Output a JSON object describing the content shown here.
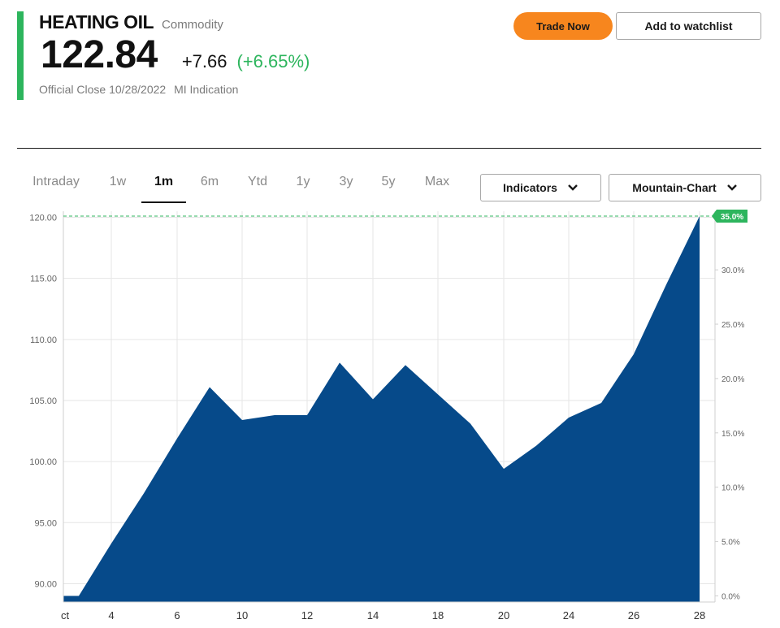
{
  "header": {
    "title": "HEATING OIL",
    "category": "Commodity",
    "price": "122.84",
    "change": "+7.66",
    "change_pct": "(+6.65%)",
    "close_label": "Official Close 10/28/2022",
    "source_label": "MI Indication",
    "trade_label": "Trade Now",
    "watchlist_label": "Add to watchlist"
  },
  "colors": {
    "accent_green": "#2db55d",
    "trade_orange": "#f7861e",
    "area_fill": "#064a8a"
  },
  "tabs": [
    {
      "label": "Intraday",
      "active": false
    },
    {
      "label": "1w",
      "active": false
    },
    {
      "label": "1m",
      "active": true
    },
    {
      "label": "6m",
      "active": false
    },
    {
      "label": "Ytd",
      "active": false
    },
    {
      "label": "1y",
      "active": false
    },
    {
      "label": "3y",
      "active": false
    },
    {
      "label": "5y",
      "active": false
    },
    {
      "label": "Max",
      "active": false
    }
  ],
  "dropdowns": {
    "indicators": "Indicators",
    "chart_type": "Mountain-Chart"
  },
  "chart_data": {
    "type": "area",
    "x": [
      2,
      3,
      4,
      5,
      6,
      7,
      8,
      9,
      10,
      11,
      12,
      13,
      14,
      15,
      16,
      17,
      18,
      19,
      20,
      21,
      22,
      23,
      24,
      25,
      26,
      27,
      28
    ],
    "values": [
      89.0,
      89.0,
      93.3,
      97.4,
      101.9,
      106.1,
      103.4,
      103.8,
      103.8,
      108.1,
      105.1,
      107.9,
      105.5,
      103.1,
      99.4,
      101.3,
      103.6,
      104.8,
      108.8,
      114.5,
      120.1
    ],
    "dates": [
      "Oct 2",
      "Oct 3",
      "Oct 4",
      "Oct 5",
      "Oct 6",
      "Oct 7",
      "Oct 10",
      "Oct 11",
      "Oct 12",
      "Oct 13",
      "Oct 14",
      "Oct 17",
      "Oct 18",
      "Oct 19",
      "Oct 20",
      "Oct 21",
      "Oct 24",
      "Oct 25",
      "Oct 26",
      "Oct 27",
      "Oct 28"
    ],
    "x_ticks": [
      "ct",
      "4",
      "6",
      "10",
      "12",
      "14",
      "18",
      "20",
      "24",
      "26",
      "28"
    ],
    "y_ticks": [
      "120.00",
      "115.00",
      "110.00",
      "105.00",
      "100.00",
      "95.00",
      "90.00"
    ],
    "y_tick_values": [
      120,
      115,
      110,
      105,
      100,
      95,
      90
    ],
    "y2_ticks": [
      "30.0%",
      "25.0%",
      "20.0%",
      "15.0%",
      "10.0%",
      "5.0%",
      "0.0%"
    ],
    "y2_tick_values": [
      30,
      25,
      20,
      15,
      10,
      5,
      0
    ],
    "last_pct_label": "35.0%",
    "ylim": [
      88.5,
      120.5
    ],
    "grid": true
  }
}
